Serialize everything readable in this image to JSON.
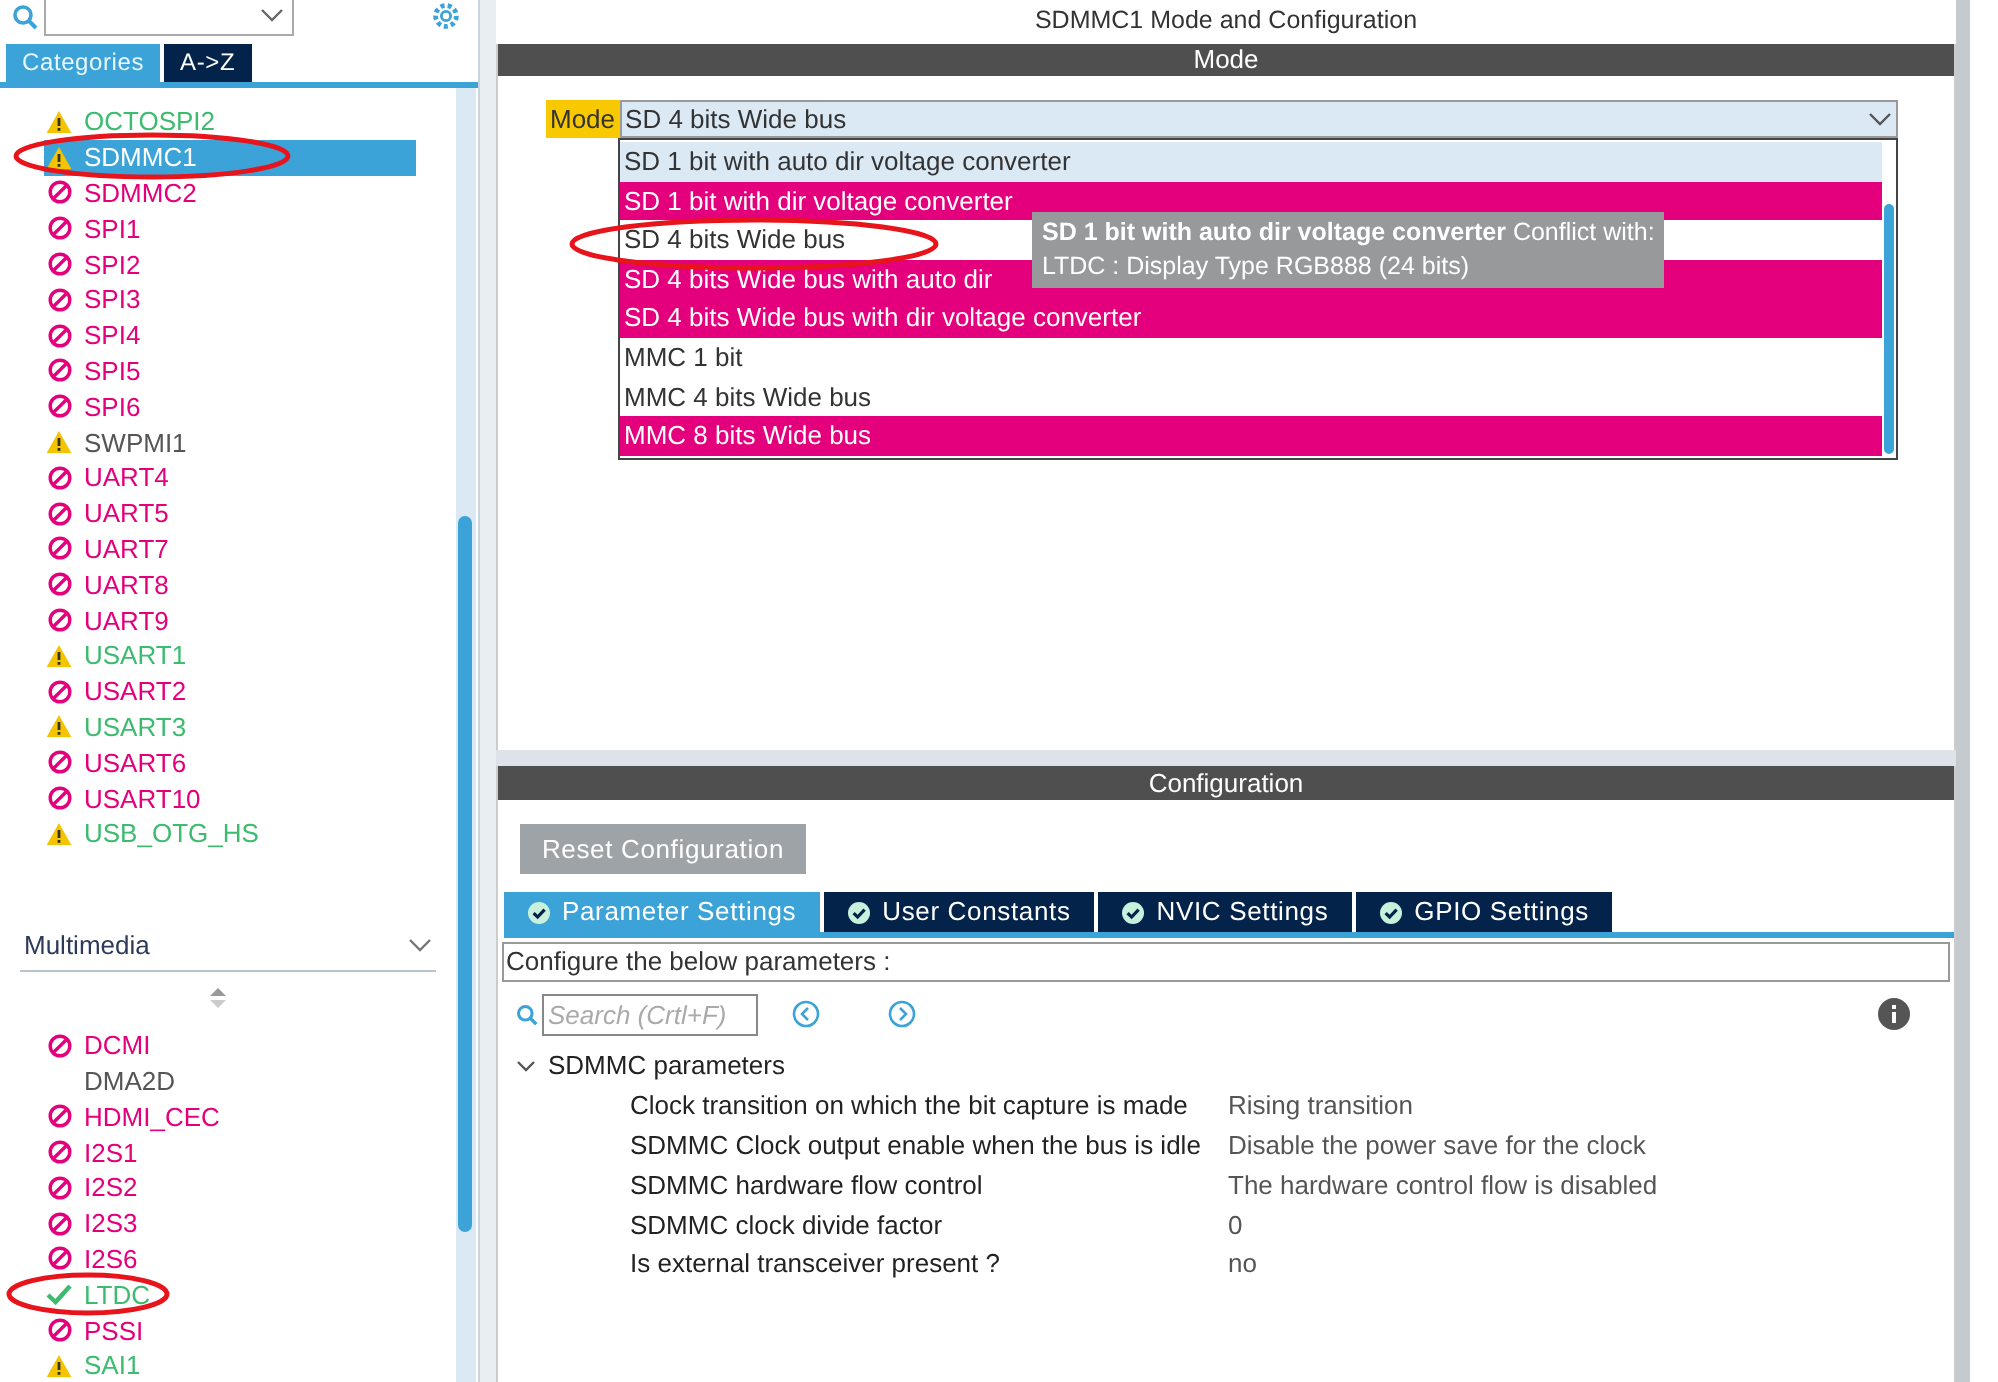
{
  "sidebar": {
    "tabs": [
      {
        "label": "Categories",
        "selected": true
      },
      {
        "label": "A->Z",
        "selected": false
      }
    ],
    "items": [
      {
        "label": "OCTOSPI2",
        "kind": "warning",
        "color": "#3dbb6f",
        "selected": false
      },
      {
        "label": "SDMMC1",
        "kind": "warning",
        "selected": true
      },
      {
        "label": "SDMMC2",
        "kind": "blocked",
        "color": "#e4007c",
        "selected": false
      },
      {
        "label": "SPI1",
        "kind": "blocked",
        "color": "#e4007c",
        "selected": false
      },
      {
        "label": "SPI2",
        "kind": "blocked",
        "color": "#e4007c",
        "selected": false
      },
      {
        "label": "SPI3",
        "kind": "blocked",
        "color": "#e4007c",
        "selected": false
      },
      {
        "label": "SPI4",
        "kind": "blocked",
        "color": "#e4007c",
        "selected": false
      },
      {
        "label": "SPI5",
        "kind": "blocked",
        "color": "#e4007c",
        "selected": false
      },
      {
        "label": "SPI6",
        "kind": "blocked",
        "color": "#e4007c",
        "selected": false
      },
      {
        "label": "SWPMI1",
        "kind": "warning",
        "color": "#555555",
        "selected": false
      },
      {
        "label": "UART4",
        "kind": "blocked",
        "color": "#e4007c",
        "selected": false
      },
      {
        "label": "UART5",
        "kind": "blocked",
        "color": "#e4007c",
        "selected": false
      },
      {
        "label": "UART7",
        "kind": "blocked",
        "color": "#e4007c",
        "selected": false
      },
      {
        "label": "UART8",
        "kind": "blocked",
        "color": "#e4007c",
        "selected": false
      },
      {
        "label": "UART9",
        "kind": "blocked",
        "color": "#e4007c",
        "selected": false
      },
      {
        "label": "USART1",
        "kind": "warning",
        "color": "#3dbb6f",
        "selected": false
      },
      {
        "label": "USART2",
        "kind": "blocked",
        "color": "#e4007c",
        "selected": false
      },
      {
        "label": "USART3",
        "kind": "warning",
        "color": "#3dbb6f",
        "selected": false
      },
      {
        "label": "USART6",
        "kind": "blocked",
        "color": "#e4007c",
        "selected": false
      },
      {
        "label": "USART10",
        "kind": "blocked",
        "color": "#e4007c",
        "selected": false
      },
      {
        "label": "USB_OTG_HS",
        "kind": "warning",
        "color": "#3dbb6f",
        "selected": false
      }
    ],
    "section": {
      "label": "Multimedia",
      "expanded": true
    },
    "section_items": [
      {
        "label": "DCMI",
        "kind": "blocked",
        "color": "#e4007c",
        "selected": false
      },
      {
        "label": "DMA2D",
        "kind": "none",
        "color": "#555555",
        "selected": false
      },
      {
        "label": "HDMI_CEC",
        "kind": "blocked",
        "color": "#e4007c",
        "selected": false
      },
      {
        "label": "I2S1",
        "kind": "blocked",
        "color": "#e4007c",
        "selected": false
      },
      {
        "label": "I2S2",
        "kind": "blocked",
        "color": "#e4007c",
        "selected": false
      },
      {
        "label": "I2S3",
        "kind": "blocked",
        "color": "#e4007c",
        "selected": false
      },
      {
        "label": "I2S6",
        "kind": "blocked",
        "color": "#e4007c",
        "selected": false
      },
      {
        "label": "LTDC",
        "kind": "ok",
        "color": "#3dbb6f",
        "selected": false
      },
      {
        "label": "PSSI",
        "kind": "blocked",
        "color": "#e4007c",
        "selected": false
      },
      {
        "label": "SAI1",
        "kind": "warning",
        "color": "#3dbb6f",
        "selected": false
      }
    ]
  },
  "main": {
    "title": "SDMMC1 Mode and Configuration",
    "mode_panel": {
      "header": "Mode",
      "label": "Mode",
      "value": "SD 4 bits Wide bus",
      "options": [
        {
          "label": "SD 1 bit with auto dir voltage converter",
          "available": true,
          "hovered": true
        },
        {
          "label": "SD 1 bit with dir voltage converter",
          "available": false,
          "hovered": false
        },
        {
          "label": "SD 4 bits Wide bus",
          "available": true,
          "hovered": false
        },
        {
          "label": "SD 4 bits Wide bus with auto dir",
          "available": false,
          "hovered": false
        },
        {
          "label": "SD 4 bits Wide bus with dir voltage converter",
          "available": false,
          "hovered": false
        },
        {
          "label": "MMC 1 bit",
          "available": true,
          "hovered": false
        },
        {
          "label": "MMC 4 bits Wide bus",
          "available": true,
          "hovered": false
        },
        {
          "label": "MMC 8 bits Wide bus",
          "available": false,
          "hovered": false
        }
      ],
      "tooltip": [
        "**SD 1 bit with auto dir voltage converter** Conflict with:",
        "LTDC : Display Type RGB888 (24 bits)"
      ]
    },
    "config_panel": {
      "header": "Configuration",
      "reset_button": "Reset Configuration",
      "tabs": [
        {
          "label": "Parameter Settings",
          "selected": true
        },
        {
          "label": "User Constants",
          "selected": false
        },
        {
          "label": "NVIC Settings",
          "selected": false
        },
        {
          "label": "GPIO Settings",
          "selected": false
        }
      ],
      "hint": "Configure the below parameters :",
      "search": {
        "placeholder": "Search (Crtl+F)"
      },
      "group": {
        "label": "SDMMC parameters",
        "expanded": true,
        "rows": [
          {
            "name": "Clock transition on which the bit capture is made",
            "value": "Rising transition"
          },
          {
            "name": "SDMMC Clock output enable when the bus is idle",
            "value": "Disable the power save for the clock"
          },
          {
            "name": "SDMMC hardware flow control",
            "value": "The hardware control flow is disabled"
          },
          {
            "name": "SDMMC clock divide factor",
            "value": "0"
          },
          {
            "name": "Is external transceiver present ?",
            "value": "no"
          }
        ]
      }
    }
  }
}
